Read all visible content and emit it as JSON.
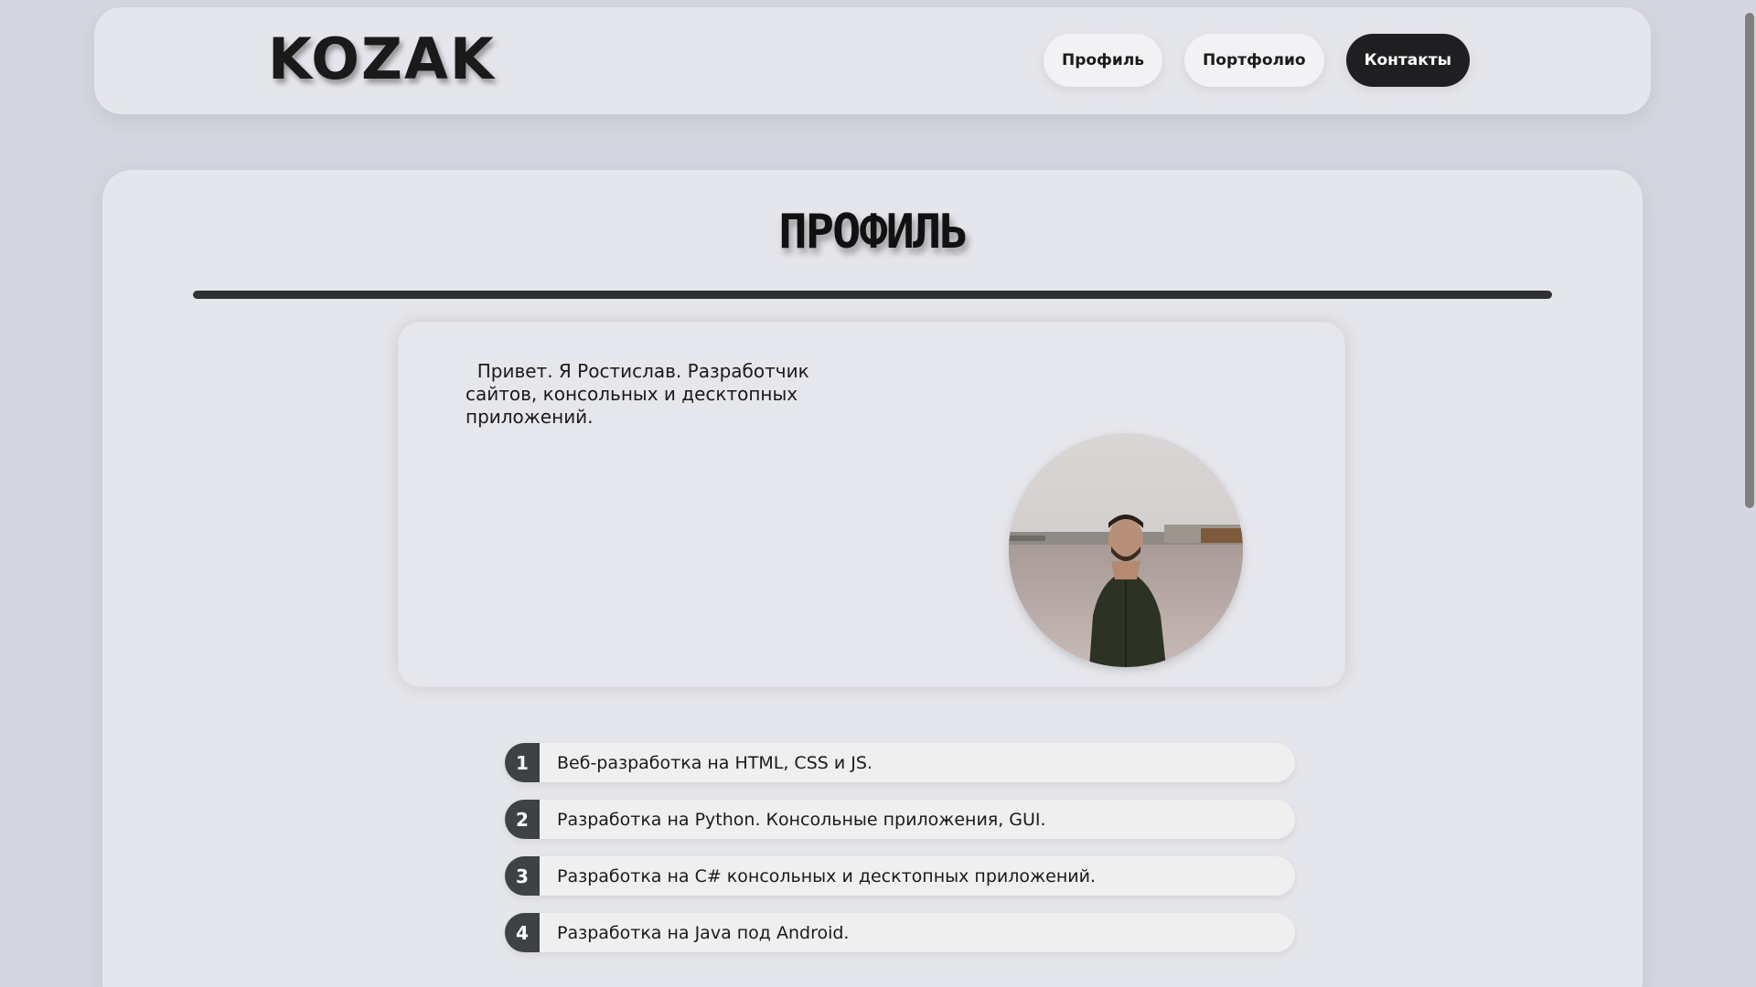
{
  "header": {
    "logo": "KOZAK",
    "nav": [
      {
        "label": "Профиль"
      },
      {
        "label": "Портфолио"
      },
      {
        "label": "Контакты"
      }
    ]
  },
  "main": {
    "title": "ПРОФИЛЬ",
    "intro": "  Привет. Я Ростислав. Разработчик сайтов, консольных и десктопных приложений.",
    "skills": [
      {
        "num": "1",
        "text": "Веб-разработка на HTML, CSS и JS."
      },
      {
        "num": "2",
        "text": "Разработка на Python. Консольные приложения, GUI."
      },
      {
        "num": "3",
        "text": "Разработка на C# консольных и десктопных приложений."
      },
      {
        "num": "4",
        "text": "Разработка на Java под Android."
      }
    ]
  },
  "colors": {
    "background": "#d5d6df",
    "card": "#e5e6eb",
    "accent_dark": "#1f1f21",
    "number_badge": "#3d4345"
  }
}
